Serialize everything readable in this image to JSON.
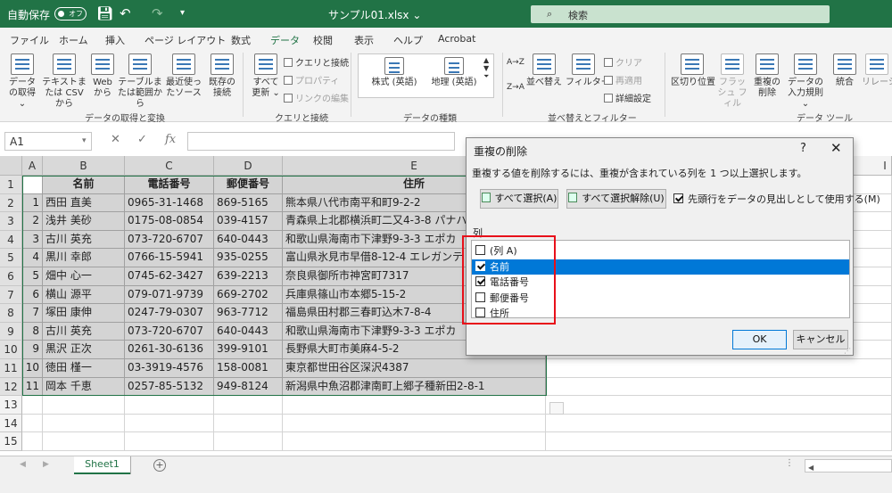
{
  "titlebar": {
    "autosave_label": "自動保存",
    "autosave_state": "オフ",
    "filename": "サンプル01.xlsx ⌄",
    "search_placeholder": "検索",
    "search_icon": "search-icon"
  },
  "menu": {
    "tabs": [
      "ファイル",
      "ホーム",
      "挿入",
      "ページ レイアウト",
      "数式",
      "データ",
      "校閲",
      "表示",
      "ヘルプ",
      "Acrobat"
    ],
    "active": "データ"
  },
  "ribbon": {
    "get_data": "データの取得 ⌄",
    "from_text_csv": "テキストまたは CSV から",
    "from_web": "Web から",
    "from_table": "テーブルまたは範囲から",
    "recent_sources": "最近使ったソース",
    "existing_connections": "既存の接続",
    "group_get_transform": "データの取得と変換",
    "refresh_all": "すべて更新 ⌄",
    "queries_connections": "クエリと接続",
    "properties": "プロパティ",
    "edit_links": "リンクの編集",
    "group_queries": "クエリと接続",
    "stocks": "株式 (英語)",
    "geography": "地理 (英語)",
    "group_data_types": "データの種類",
    "sort_az": "A→Z",
    "sort_za": "Z→A",
    "sort": "並べ替え",
    "filter": "フィルター",
    "clear": "クリア",
    "reapply": "再適用",
    "advanced": "詳細設定",
    "group_sort_filter": "並べ替えとフィルター",
    "text_to_columns": "区切り位置",
    "flash_fill": "フラッシュ フィル",
    "remove_duplicates": "重複の削除",
    "data_validation": "データの入力規則 ⌄",
    "consolidate": "統合",
    "relationships": "リレーショ",
    "group_data_tools": "データ ツール"
  },
  "formula_bar": {
    "name_box": "A1",
    "fx": "fx",
    "cancel": "✕",
    "enter": "✓",
    "value": ""
  },
  "sheet": {
    "columns": [
      "A",
      "B",
      "C",
      "D",
      "E"
    ],
    "header": [
      "",
      "名前",
      "電話番号",
      "郵便番号",
      "住所"
    ],
    "rows": [
      [
        "1",
        "西田 直美",
        "0965-31-1468",
        "869-5165",
        "熊本県八代市南平和町9-2-2"
      ],
      [
        "2",
        "浅井 美砂",
        "0175-08-0854",
        "039-4157",
        "青森県上北郡横浜町二又4-3-8 パナハ"
      ],
      [
        "3",
        "古川 英充",
        "073-720-6707",
        "640-0443",
        "和歌山県海南市下津野9-3-3 エポカ"
      ],
      [
        "4",
        "黒川 幸郎",
        "0766-15-5941",
        "935-0255",
        "富山県氷見市早借8-12-4 エレガンテ"
      ],
      [
        "5",
        "畑中 心一",
        "0745-62-3427",
        "639-2213",
        "奈良県御所市神宮町7317"
      ],
      [
        "6",
        "横山 源平",
        "079-071-9739",
        "669-2702",
        "兵庫県篠山市本郷5-15-2"
      ],
      [
        "7",
        "塚田 康伸",
        "0247-79-0307",
        "963-7712",
        "福島県田村郡三春町込木7-8-4"
      ],
      [
        "8",
        "古川 英充",
        "073-720-6707",
        "640-0443",
        "和歌山県海南市下津野9-3-3 エポカ"
      ],
      [
        "9",
        "黒沢 正次",
        "0261-30-6136",
        "399-9101",
        "長野県大町市美麻4-5-2"
      ],
      [
        "10",
        "徳田 槿一",
        "03-3919-4576",
        "158-0081",
        "東京都世田谷区深沢4387"
      ],
      [
        "11",
        "岡本 千恵",
        "0257-85-5132",
        "949-8124",
        "新潟県中魚沼郡津南町上郷子種新田2-8-1"
      ]
    ],
    "row_numbers": [
      "1",
      "2",
      "3",
      "4",
      "5",
      "6",
      "7",
      "8",
      "9",
      "10",
      "11",
      "12",
      "13",
      "14",
      "15"
    ],
    "right_col_label": "I"
  },
  "tabs": {
    "sheet1": "Sheet1",
    "add": "+"
  },
  "dialog": {
    "title": "重複の削除",
    "help": "?",
    "close": "✕",
    "message": "重複する値を削除するには、重複が含まれている列を 1 つ以上選択します。",
    "select_all": "すべて選択(A)",
    "unselect_all": "すべて選択解除(U)",
    "has_headers": "先頭行をデータの見出しとして使用する(M)",
    "has_headers_checked": true,
    "columns_label": "列",
    "columns": [
      {
        "label": "(列 A)",
        "checked": false,
        "selected": false
      },
      {
        "label": "名前",
        "checked": true,
        "selected": true
      },
      {
        "label": "電話番号",
        "checked": true,
        "selected": false
      },
      {
        "label": "郵便番号",
        "checked": false,
        "selected": false
      },
      {
        "label": "住所",
        "checked": false,
        "selected": false
      }
    ],
    "ok": "OK",
    "cancel": "キャンセル"
  },
  "colors": {
    "excel_green": "#217346",
    "selection_highlight": "#0078d7",
    "annotation_red": "#e8101a"
  }
}
